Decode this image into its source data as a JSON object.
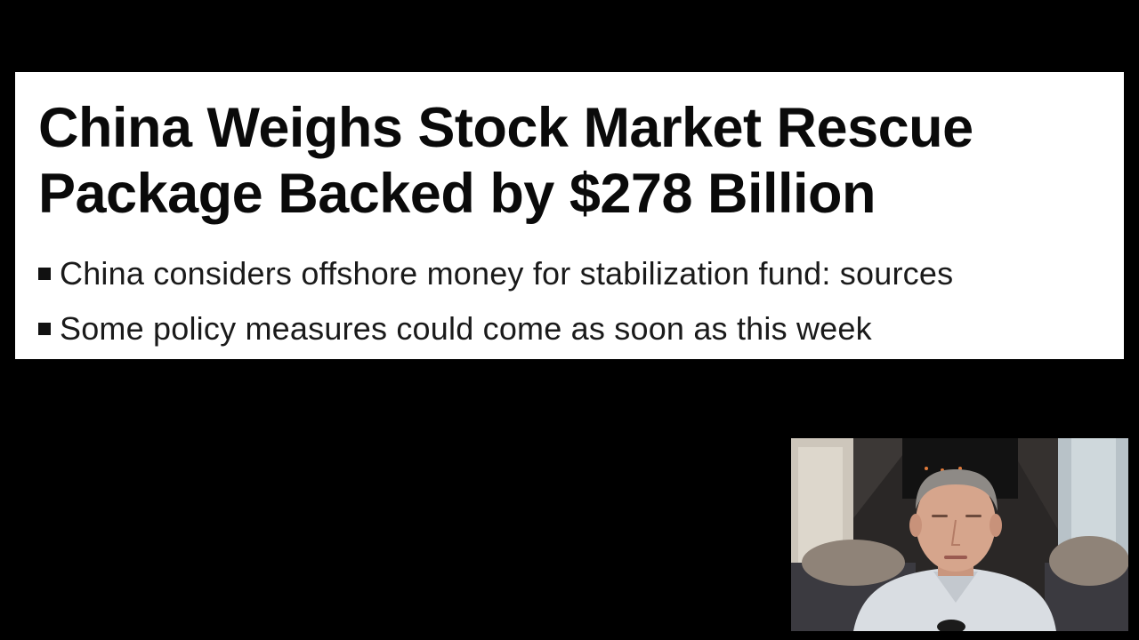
{
  "article": {
    "headline": "China Weighs Stock Market Rescue Package Backed by $278 Billion",
    "headline_lines": [
      "China Weighs Stock Market Rescue",
      "Package Backed by $278 Billion"
    ],
    "bullets": [
      "China considers offshore money for stabilization fund: sources",
      "Some policy measures could come as soon as this week"
    ]
  },
  "webcam": {
    "subject": "presenter",
    "background_color": "#2b2622"
  },
  "colors": {
    "page_background": "#000000",
    "card_background": "#ffffff",
    "text": "#0a0a0a"
  }
}
